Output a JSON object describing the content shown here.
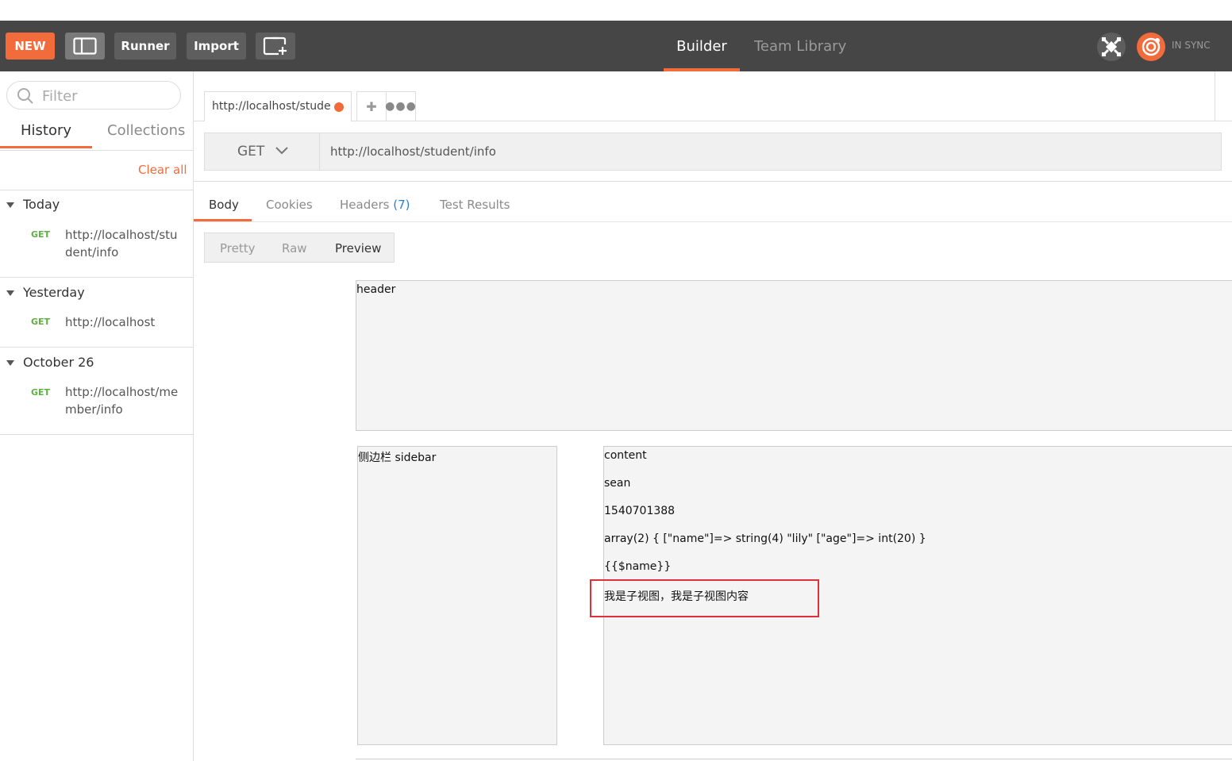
{
  "toolbar": {
    "new_label": "NEW",
    "runner_label": "Runner",
    "import_label": "Import",
    "tabs": [
      {
        "label": "Builder",
        "active": true
      },
      {
        "label": "Team Library",
        "active": false
      }
    ],
    "sync_status": "IN SYNC",
    "accent_color": "#f26b3a"
  },
  "sidebar": {
    "filter_placeholder": "Filter",
    "tabs": [
      {
        "label": "History",
        "active": true
      },
      {
        "label": "Collections",
        "active": false
      }
    ],
    "clear_all": "Clear all",
    "groups": [
      {
        "title": "Today",
        "items": [
          {
            "method": "GET",
            "url": "http://localhost/student/info"
          }
        ]
      },
      {
        "title": "Yesterday",
        "items": [
          {
            "method": "GET",
            "url": "http://localhost"
          }
        ]
      },
      {
        "title": "October 26",
        "items": [
          {
            "method": "GET",
            "url": "http://localhost/member/info"
          }
        ]
      }
    ]
  },
  "request": {
    "tab_label": "http://localhost/stude",
    "method": "GET",
    "url": "http://localhost/student/info"
  },
  "response": {
    "tabs": [
      {
        "label": "Body",
        "active": true
      },
      {
        "label": "Cookies"
      },
      {
        "label": "Headers",
        "count": "(7)"
      },
      {
        "label": "Test Results"
      }
    ],
    "view_modes": [
      {
        "label": "Pretty"
      },
      {
        "label": "Raw"
      },
      {
        "label": "Preview",
        "active": true
      }
    ],
    "preview": {
      "header": "header",
      "sidebar": "侧边栏 sidebar",
      "content_lines": [
        "content",
        "sean",
        "1540701388",
        "array(2) { [\"name\"]=> string(4) \"lily\" [\"age\"]=> int(20) }",
        "{{$name}}",
        "我是子视图，我是子视图内容"
      ]
    }
  }
}
